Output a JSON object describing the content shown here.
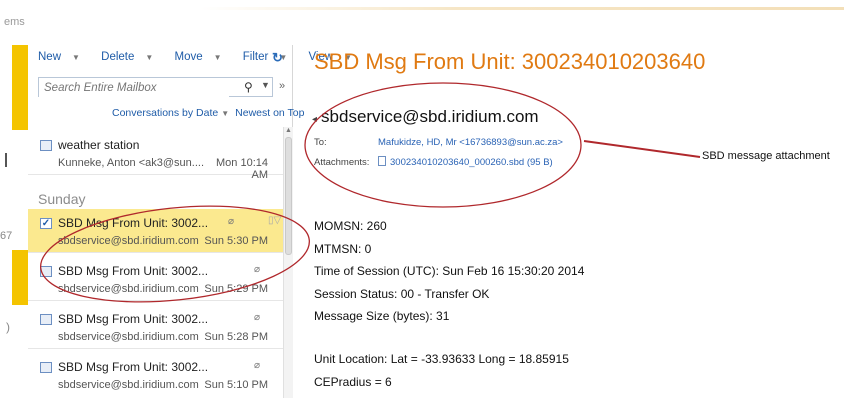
{
  "top_fragment": "ems",
  "left_rail": {
    "number": "67",
    "paren": ")"
  },
  "toolbar": {
    "new": "New",
    "delete": "Delete",
    "move": "Move",
    "filter": "Filter",
    "view": "View",
    "refresh_icon": "refresh-icon"
  },
  "search": {
    "placeholder": "Search Entire Mailbox"
  },
  "sort": {
    "by": "Conversations by Date",
    "order": "Newest on Top"
  },
  "group_label": "Sunday",
  "messages": [
    {
      "from": "weather station",
      "sub": "Kunneke, Anton <ak3@sun....",
      "time": "Mon 10:14 AM",
      "selected": false
    },
    {
      "from": "SBD Msg From Unit: 3002...",
      "sub": "sbdservice@sbd.iridium.com",
      "time": "Sun 5:30 PM",
      "selected": true
    },
    {
      "from": "SBD Msg From Unit: 3002...",
      "sub": "sbdservice@sbd.iridium.com",
      "time": "Sun 5:29 PM",
      "selected": false
    },
    {
      "from": "SBD Msg From Unit: 3002...",
      "sub": "sbdservice@sbd.iridium.com",
      "time": "Sun 5:28 PM",
      "selected": false
    },
    {
      "from": "SBD Msg From Unit: 3002...",
      "sub": "sbdservice@sbd.iridium.com",
      "time": "Sun 5:10 PM",
      "selected": false
    }
  ],
  "reading": {
    "subject": "SBD Msg From Unit: 300234010203640",
    "sender": "sbdservice@sbd.iridium.com",
    "to_label": "To:",
    "to_value": "Mafukidze, HD, Mr <16736893@sun.ac.za>",
    "attach_label": "Attachments:",
    "attach_value": "300234010203640_000260.sbd (95 B)",
    "body": [
      "MOMSN: 260",
      "MTMSN: 0",
      "Time of Session (UTC): Sun Feb 16 15:30:20 2014",
      "Session Status: 00 - Transfer OK",
      "Message Size (bytes): 31",
      "Unit Location: Lat = -33.93633 Long = 18.85915",
      "CEPradius = 6"
    ]
  },
  "annotation": {
    "label": "SBD message attachment",
    "color": "#b0282c"
  },
  "colors": {
    "accent_orange": "#e07a12",
    "selection_yellow": "#fbe98f",
    "link_blue": "#1f5ca8"
  }
}
